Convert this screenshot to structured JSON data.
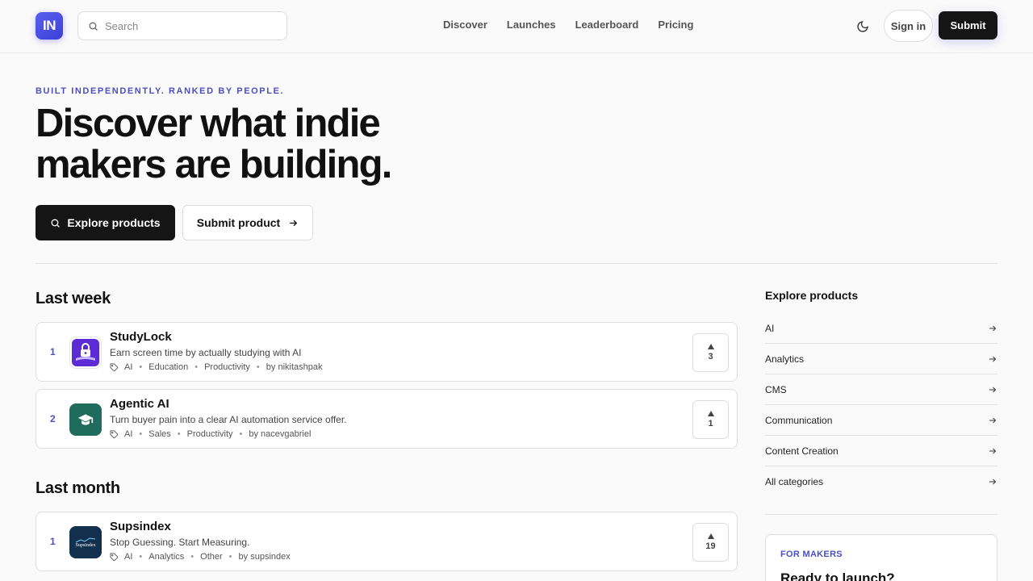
{
  "header": {
    "logo_text": "IN",
    "search_placeholder": "Search",
    "nav": [
      "Discover",
      "Launches",
      "Leaderboard",
      "Pricing"
    ],
    "signin_label": "Sign in",
    "submit_label": "Submit"
  },
  "hero": {
    "eyebrow": "BUILT INDEPENDENTLY. RANKED BY PEOPLE.",
    "title": "Discover what indie makers are building.",
    "explore_label": "Explore products",
    "submit_label": "Submit product"
  },
  "last_week": {
    "title": "Last week",
    "items": [
      {
        "rank": "1",
        "name": "StudyLock",
        "tagline": "Earn screen time by actually studying with AI",
        "tags": [
          "AI",
          "Education",
          "Productivity"
        ],
        "by": "by nikitashpak",
        "votes": "3",
        "icon_color": "#5b2bd6"
      },
      {
        "rank": "2",
        "name": "Agentic AI",
        "tagline": "Turn buyer pain into a clear AI automation service offer.",
        "tags": [
          "AI",
          "Sales",
          "Productivity"
        ],
        "by": "by nacevgabriel",
        "votes": "1",
        "icon_color": "#1f6b5c"
      }
    ]
  },
  "last_month": {
    "title": "Last month",
    "items": [
      {
        "rank": "1",
        "name": "Supsindex",
        "tagline": "Stop Guessing. Start Measuring.",
        "tags": [
          "AI",
          "Analytics",
          "Other"
        ],
        "by": "by supsindex",
        "votes": "19",
        "icon_color": "#14304f",
        "icon_text": "Supsindex"
      }
    ]
  },
  "sidebar": {
    "title": "Explore products",
    "items": [
      "AI",
      "Analytics",
      "CMS",
      "Communication",
      "Content Creation",
      "All categories"
    ],
    "makers_eyebrow": "FOR MAKERS",
    "makers_heading": "Ready to launch?"
  },
  "colors": {
    "accent": "#4a4fc4",
    "dark": "#151515"
  }
}
